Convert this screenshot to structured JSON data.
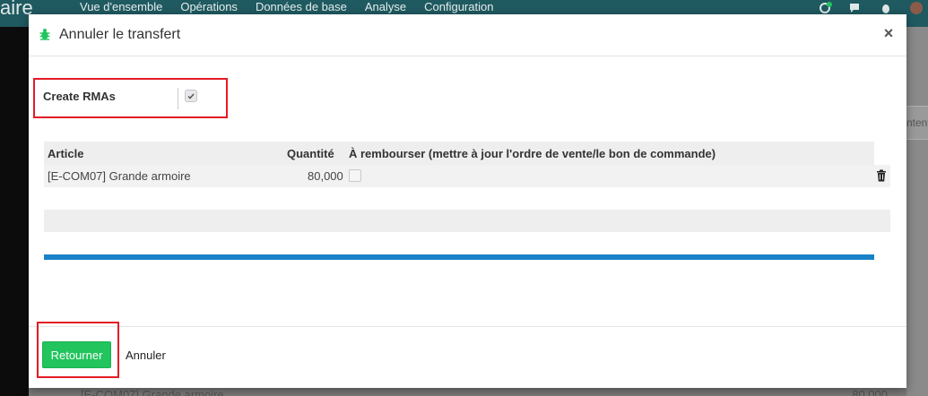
{
  "background": {
    "brand_fragment": "aire",
    "menu": [
      "Vue d'ensemble",
      "Opérations",
      "Données de base",
      "Analyse",
      "Configuration"
    ],
    "activity_count": "1",
    "right_button_fragment": "ntente",
    "bottom_row": {
      "item": "[E-COM07] Grande armoire",
      "qty": "80,000"
    },
    "user_initial": "M"
  },
  "dialog": {
    "title": "Annuler le transfert",
    "field": {
      "label": "Create RMAs",
      "checked": true
    },
    "table": {
      "headers": [
        "Article",
        "Quantité",
        "À rembourser (mettre à jour l'ordre de vente/le bon de commande)"
      ],
      "rows": [
        {
          "article": "[E-COM07] Grande armoire",
          "quantity": "80,000",
          "to_refund": false
        }
      ]
    },
    "footer": {
      "primary_label": "Retourner",
      "cancel_label": "Annuler"
    }
  },
  "colors": {
    "topbar": "#1f5a60",
    "primary_button": "#21c45d",
    "highlight_box": "#e31b23",
    "progress_bar": "#1981c8"
  },
  "icons": {
    "title_icon": "bug-icon",
    "close": "close-icon",
    "delete": "trash-icon"
  }
}
